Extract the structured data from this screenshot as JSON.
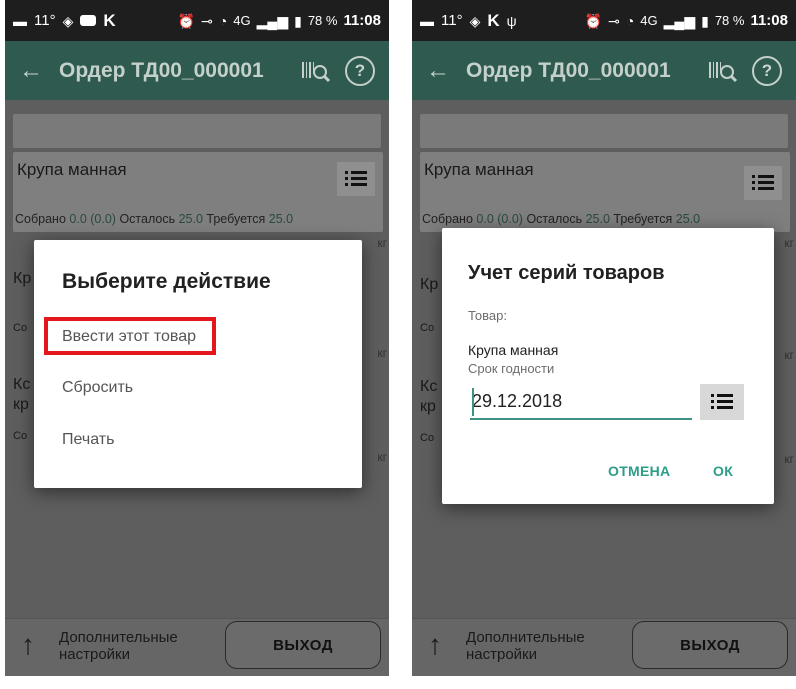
{
  "statusbar": {
    "temp": "11°",
    "letter": "K",
    "network": "4G",
    "battery": "78 %",
    "time": "11:08"
  },
  "appbar": {
    "title": "Ордер ТД00_000001",
    "help": "?"
  },
  "items": [
    {
      "name": "Крупа манная",
      "collected_label": "Собрано",
      "collected": "0.0 (0.0)",
      "remaining_label": "Осталось",
      "remaining": "25.0",
      "required_label": "Требуется",
      "required": "25.0",
      "unit": "кг"
    }
  ],
  "fragments": {
    "item2_name": "Кр",
    "item2_stats": "Со",
    "item3_name_line1": "Кс",
    "item3_name_line2": "кр",
    "item3_stats": "Со",
    "unit": "кг"
  },
  "bottombar": {
    "more_line1": "Дополнительные",
    "more_line2": "настройки",
    "exit": "ВЫХОД"
  },
  "action_dialog": {
    "title": "Выберите действие",
    "items": [
      "Ввести этот товар",
      "Сбросить",
      "Печать"
    ]
  },
  "series_dialog": {
    "title": "Учет серий товаров",
    "product_label": "Товар:",
    "product_value": "Крупа манная",
    "expiry_label": "Срок годности",
    "expiry_value": "29.12.2018",
    "cancel": "ОТМЕНА",
    "ok": "ОК"
  },
  "colors": {
    "accent": "#2c9d88",
    "highlight": "#e3181f",
    "appbar": "#2f5a4f"
  }
}
